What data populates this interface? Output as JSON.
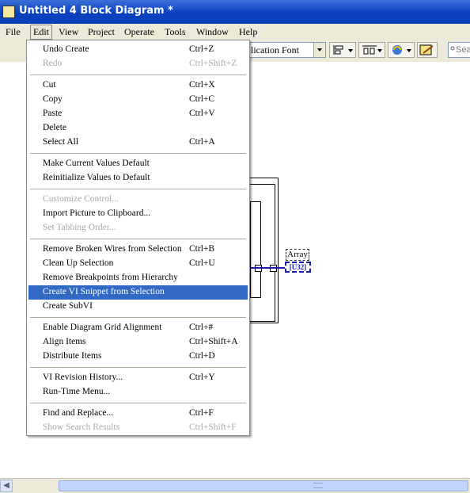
{
  "window": {
    "title": "Untitled 4 Block Diagram *"
  },
  "menubar": [
    {
      "label": "File",
      "active": false
    },
    {
      "label": "Edit",
      "active": true
    },
    {
      "label": "View",
      "active": false
    },
    {
      "label": "Project",
      "active": false
    },
    {
      "label": "Operate",
      "active": false
    },
    {
      "label": "Tools",
      "active": false
    },
    {
      "label": "Window",
      "active": false
    },
    {
      "label": "Help",
      "active": false
    }
  ],
  "toolbar": {
    "font_select": "lication Font",
    "search_placeholder": "Sear"
  },
  "diagram": {
    "array_label": "Array",
    "array_terminal": "[U32]"
  },
  "edit_menu": [
    {
      "label": "Undo Create",
      "shortcut": "Ctrl+Z",
      "enabled": true
    },
    {
      "label": "Redo",
      "shortcut": "Ctrl+Shift+Z",
      "enabled": false
    },
    {
      "separator": true
    },
    {
      "label": "Cut",
      "shortcut": "Ctrl+X",
      "enabled": true
    },
    {
      "label": "Copy",
      "shortcut": "Ctrl+C",
      "enabled": true
    },
    {
      "label": "Paste",
      "shortcut": "Ctrl+V",
      "enabled": true
    },
    {
      "label": "Delete",
      "shortcut": "",
      "enabled": true
    },
    {
      "label": "Select All",
      "shortcut": "Ctrl+A",
      "enabled": true
    },
    {
      "separator": true
    },
    {
      "label": "Make Current Values Default",
      "shortcut": "",
      "enabled": true
    },
    {
      "label": "Reinitialize Values to Default",
      "shortcut": "",
      "enabled": true
    },
    {
      "separator": true
    },
    {
      "label": "Customize Control...",
      "shortcut": "",
      "enabled": false
    },
    {
      "label": "Import Picture to Clipboard...",
      "shortcut": "",
      "enabled": true
    },
    {
      "label": "Set Tabbing Order...",
      "shortcut": "",
      "enabled": false
    },
    {
      "separator": true
    },
    {
      "label": "Remove Broken Wires from Selection",
      "shortcut": "Ctrl+B",
      "enabled": true
    },
    {
      "label": "Clean Up Selection",
      "shortcut": "Ctrl+U",
      "enabled": true
    },
    {
      "label": "Remove Breakpoints from Hierarchy",
      "shortcut": "",
      "enabled": true
    },
    {
      "label": "Create VI Snippet from Selection",
      "shortcut": "",
      "enabled": true,
      "highlighted": true
    },
    {
      "label": "Create SubVI",
      "shortcut": "",
      "enabled": true
    },
    {
      "separator": true
    },
    {
      "label": "Enable Diagram Grid Alignment",
      "shortcut": "Ctrl+#",
      "enabled": true
    },
    {
      "label": "Align Items",
      "shortcut": "Ctrl+Shift+A",
      "enabled": true
    },
    {
      "label": "Distribute Items",
      "shortcut": "Ctrl+D",
      "enabled": true
    },
    {
      "separator": true
    },
    {
      "label": "VI Revision History...",
      "shortcut": "Ctrl+Y",
      "enabled": true
    },
    {
      "label": "Run-Time Menu...",
      "shortcut": "",
      "enabled": true
    },
    {
      "separator": true
    },
    {
      "label": "Find and Replace...",
      "shortcut": "Ctrl+F",
      "enabled": true
    },
    {
      "label": "Show Search Results",
      "shortcut": "Ctrl+Shift+F",
      "enabled": false
    }
  ]
}
